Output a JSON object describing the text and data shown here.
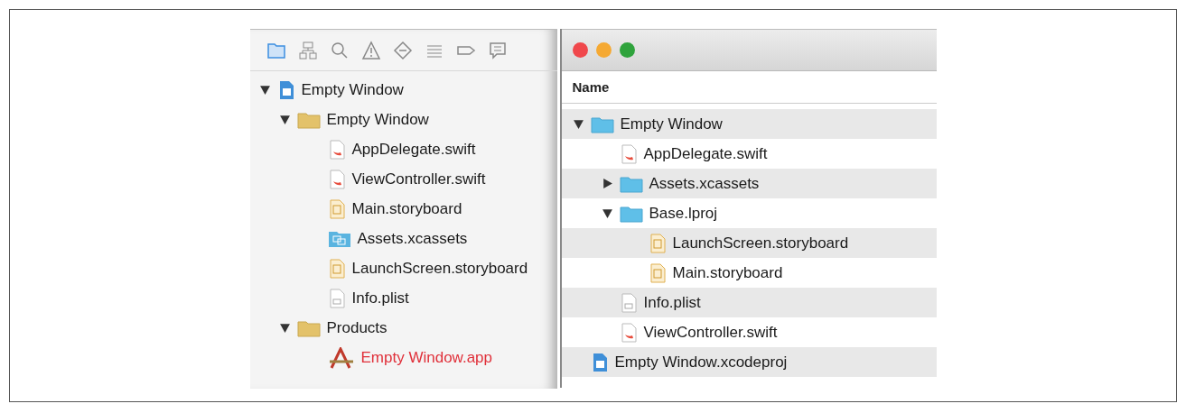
{
  "navigator": {
    "tabs": [
      {
        "kind": "folder",
        "selected": true
      },
      {
        "kind": "hierarchy",
        "selected": false
      },
      {
        "kind": "search",
        "selected": false
      },
      {
        "kind": "warning",
        "selected": false
      },
      {
        "kind": "test",
        "selected": false
      },
      {
        "kind": "debug",
        "selected": false
      },
      {
        "kind": "breakpoint",
        "selected": false
      },
      {
        "kind": "report",
        "selected": false
      }
    ],
    "tree": [
      {
        "name": "Empty Window",
        "kind": "project",
        "expanded": true,
        "children": [
          {
            "name": "Empty Window",
            "kind": "folder",
            "expanded": true,
            "children": [
              {
                "name": "AppDelegate.swift",
                "kind": "swift"
              },
              {
                "name": "ViewController.swift",
                "kind": "swift"
              },
              {
                "name": "Main.storyboard",
                "kind": "storyboard"
              },
              {
                "name": "Assets.xcassets",
                "kind": "xcassets"
              },
              {
                "name": "LaunchScreen.storyboard",
                "kind": "storyboard"
              },
              {
                "name": "Info.plist",
                "kind": "plist"
              }
            ]
          },
          {
            "name": "Products",
            "kind": "folder",
            "expanded": true,
            "children": [
              {
                "name": "Empty Window.app",
                "kind": "app",
                "missing": true
              }
            ]
          }
        ]
      }
    ]
  },
  "finder": {
    "column_header": "Name",
    "tree": [
      {
        "name": "Empty Window",
        "kind": "bluefolder",
        "expanded": true,
        "children": [
          {
            "name": "AppDelegate.swift",
            "kind": "swift"
          },
          {
            "name": "Assets.xcassets",
            "kind": "bluefolder",
            "expanded": false
          },
          {
            "name": "Base.lproj",
            "kind": "bluefolder",
            "expanded": true,
            "children": [
              {
                "name": "LaunchScreen.storyboard",
                "kind": "storyboard"
              },
              {
                "name": "Main.storyboard",
                "kind": "storyboard"
              }
            ]
          },
          {
            "name": "Info.plist",
            "kind": "plist"
          },
          {
            "name": "ViewController.swift",
            "kind": "swift"
          }
        ]
      },
      {
        "name": "Empty Window.xcodeproj",
        "kind": "project"
      }
    ]
  }
}
